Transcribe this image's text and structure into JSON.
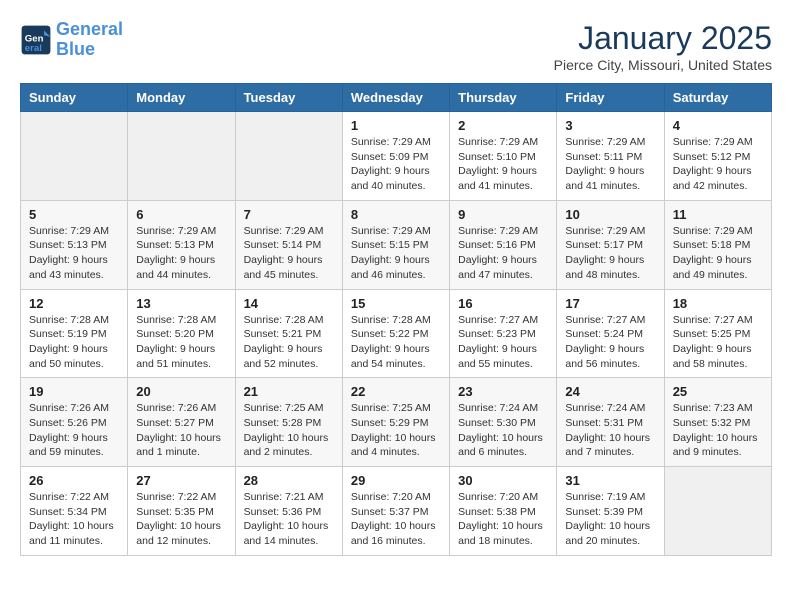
{
  "logo": {
    "line1": "General",
    "line2": "Blue"
  },
  "title": "January 2025",
  "subtitle": "Pierce City, Missouri, United States",
  "weekdays": [
    "Sunday",
    "Monday",
    "Tuesday",
    "Wednesday",
    "Thursday",
    "Friday",
    "Saturday"
  ],
  "weeks": [
    [
      {
        "day": "",
        "info": ""
      },
      {
        "day": "",
        "info": ""
      },
      {
        "day": "",
        "info": ""
      },
      {
        "day": "1",
        "info": "Sunrise: 7:29 AM\nSunset: 5:09 PM\nDaylight: 9 hours\nand 40 minutes."
      },
      {
        "day": "2",
        "info": "Sunrise: 7:29 AM\nSunset: 5:10 PM\nDaylight: 9 hours\nand 41 minutes."
      },
      {
        "day": "3",
        "info": "Sunrise: 7:29 AM\nSunset: 5:11 PM\nDaylight: 9 hours\nand 41 minutes."
      },
      {
        "day": "4",
        "info": "Sunrise: 7:29 AM\nSunset: 5:12 PM\nDaylight: 9 hours\nand 42 minutes."
      }
    ],
    [
      {
        "day": "5",
        "info": "Sunrise: 7:29 AM\nSunset: 5:13 PM\nDaylight: 9 hours\nand 43 minutes."
      },
      {
        "day": "6",
        "info": "Sunrise: 7:29 AM\nSunset: 5:13 PM\nDaylight: 9 hours\nand 44 minutes."
      },
      {
        "day": "7",
        "info": "Sunrise: 7:29 AM\nSunset: 5:14 PM\nDaylight: 9 hours\nand 45 minutes."
      },
      {
        "day": "8",
        "info": "Sunrise: 7:29 AM\nSunset: 5:15 PM\nDaylight: 9 hours\nand 46 minutes."
      },
      {
        "day": "9",
        "info": "Sunrise: 7:29 AM\nSunset: 5:16 PM\nDaylight: 9 hours\nand 47 minutes."
      },
      {
        "day": "10",
        "info": "Sunrise: 7:29 AM\nSunset: 5:17 PM\nDaylight: 9 hours\nand 48 minutes."
      },
      {
        "day": "11",
        "info": "Sunrise: 7:29 AM\nSunset: 5:18 PM\nDaylight: 9 hours\nand 49 minutes."
      }
    ],
    [
      {
        "day": "12",
        "info": "Sunrise: 7:28 AM\nSunset: 5:19 PM\nDaylight: 9 hours\nand 50 minutes."
      },
      {
        "day": "13",
        "info": "Sunrise: 7:28 AM\nSunset: 5:20 PM\nDaylight: 9 hours\nand 51 minutes."
      },
      {
        "day": "14",
        "info": "Sunrise: 7:28 AM\nSunset: 5:21 PM\nDaylight: 9 hours\nand 52 minutes."
      },
      {
        "day": "15",
        "info": "Sunrise: 7:28 AM\nSunset: 5:22 PM\nDaylight: 9 hours\nand 54 minutes."
      },
      {
        "day": "16",
        "info": "Sunrise: 7:27 AM\nSunset: 5:23 PM\nDaylight: 9 hours\nand 55 minutes."
      },
      {
        "day": "17",
        "info": "Sunrise: 7:27 AM\nSunset: 5:24 PM\nDaylight: 9 hours\nand 56 minutes."
      },
      {
        "day": "18",
        "info": "Sunrise: 7:27 AM\nSunset: 5:25 PM\nDaylight: 9 hours\nand 58 minutes."
      }
    ],
    [
      {
        "day": "19",
        "info": "Sunrise: 7:26 AM\nSunset: 5:26 PM\nDaylight: 9 hours\nand 59 minutes."
      },
      {
        "day": "20",
        "info": "Sunrise: 7:26 AM\nSunset: 5:27 PM\nDaylight: 10 hours\nand 1 minute."
      },
      {
        "day": "21",
        "info": "Sunrise: 7:25 AM\nSunset: 5:28 PM\nDaylight: 10 hours\nand 2 minutes."
      },
      {
        "day": "22",
        "info": "Sunrise: 7:25 AM\nSunset: 5:29 PM\nDaylight: 10 hours\nand 4 minutes."
      },
      {
        "day": "23",
        "info": "Sunrise: 7:24 AM\nSunset: 5:30 PM\nDaylight: 10 hours\nand 6 minutes."
      },
      {
        "day": "24",
        "info": "Sunrise: 7:24 AM\nSunset: 5:31 PM\nDaylight: 10 hours\nand 7 minutes."
      },
      {
        "day": "25",
        "info": "Sunrise: 7:23 AM\nSunset: 5:32 PM\nDaylight: 10 hours\nand 9 minutes."
      }
    ],
    [
      {
        "day": "26",
        "info": "Sunrise: 7:22 AM\nSunset: 5:34 PM\nDaylight: 10 hours\nand 11 minutes."
      },
      {
        "day": "27",
        "info": "Sunrise: 7:22 AM\nSunset: 5:35 PM\nDaylight: 10 hours\nand 12 minutes."
      },
      {
        "day": "28",
        "info": "Sunrise: 7:21 AM\nSunset: 5:36 PM\nDaylight: 10 hours\nand 14 minutes."
      },
      {
        "day": "29",
        "info": "Sunrise: 7:20 AM\nSunset: 5:37 PM\nDaylight: 10 hours\nand 16 minutes."
      },
      {
        "day": "30",
        "info": "Sunrise: 7:20 AM\nSunset: 5:38 PM\nDaylight: 10 hours\nand 18 minutes."
      },
      {
        "day": "31",
        "info": "Sunrise: 7:19 AM\nSunset: 5:39 PM\nDaylight: 10 hours\nand 20 minutes."
      },
      {
        "day": "",
        "info": ""
      }
    ]
  ]
}
